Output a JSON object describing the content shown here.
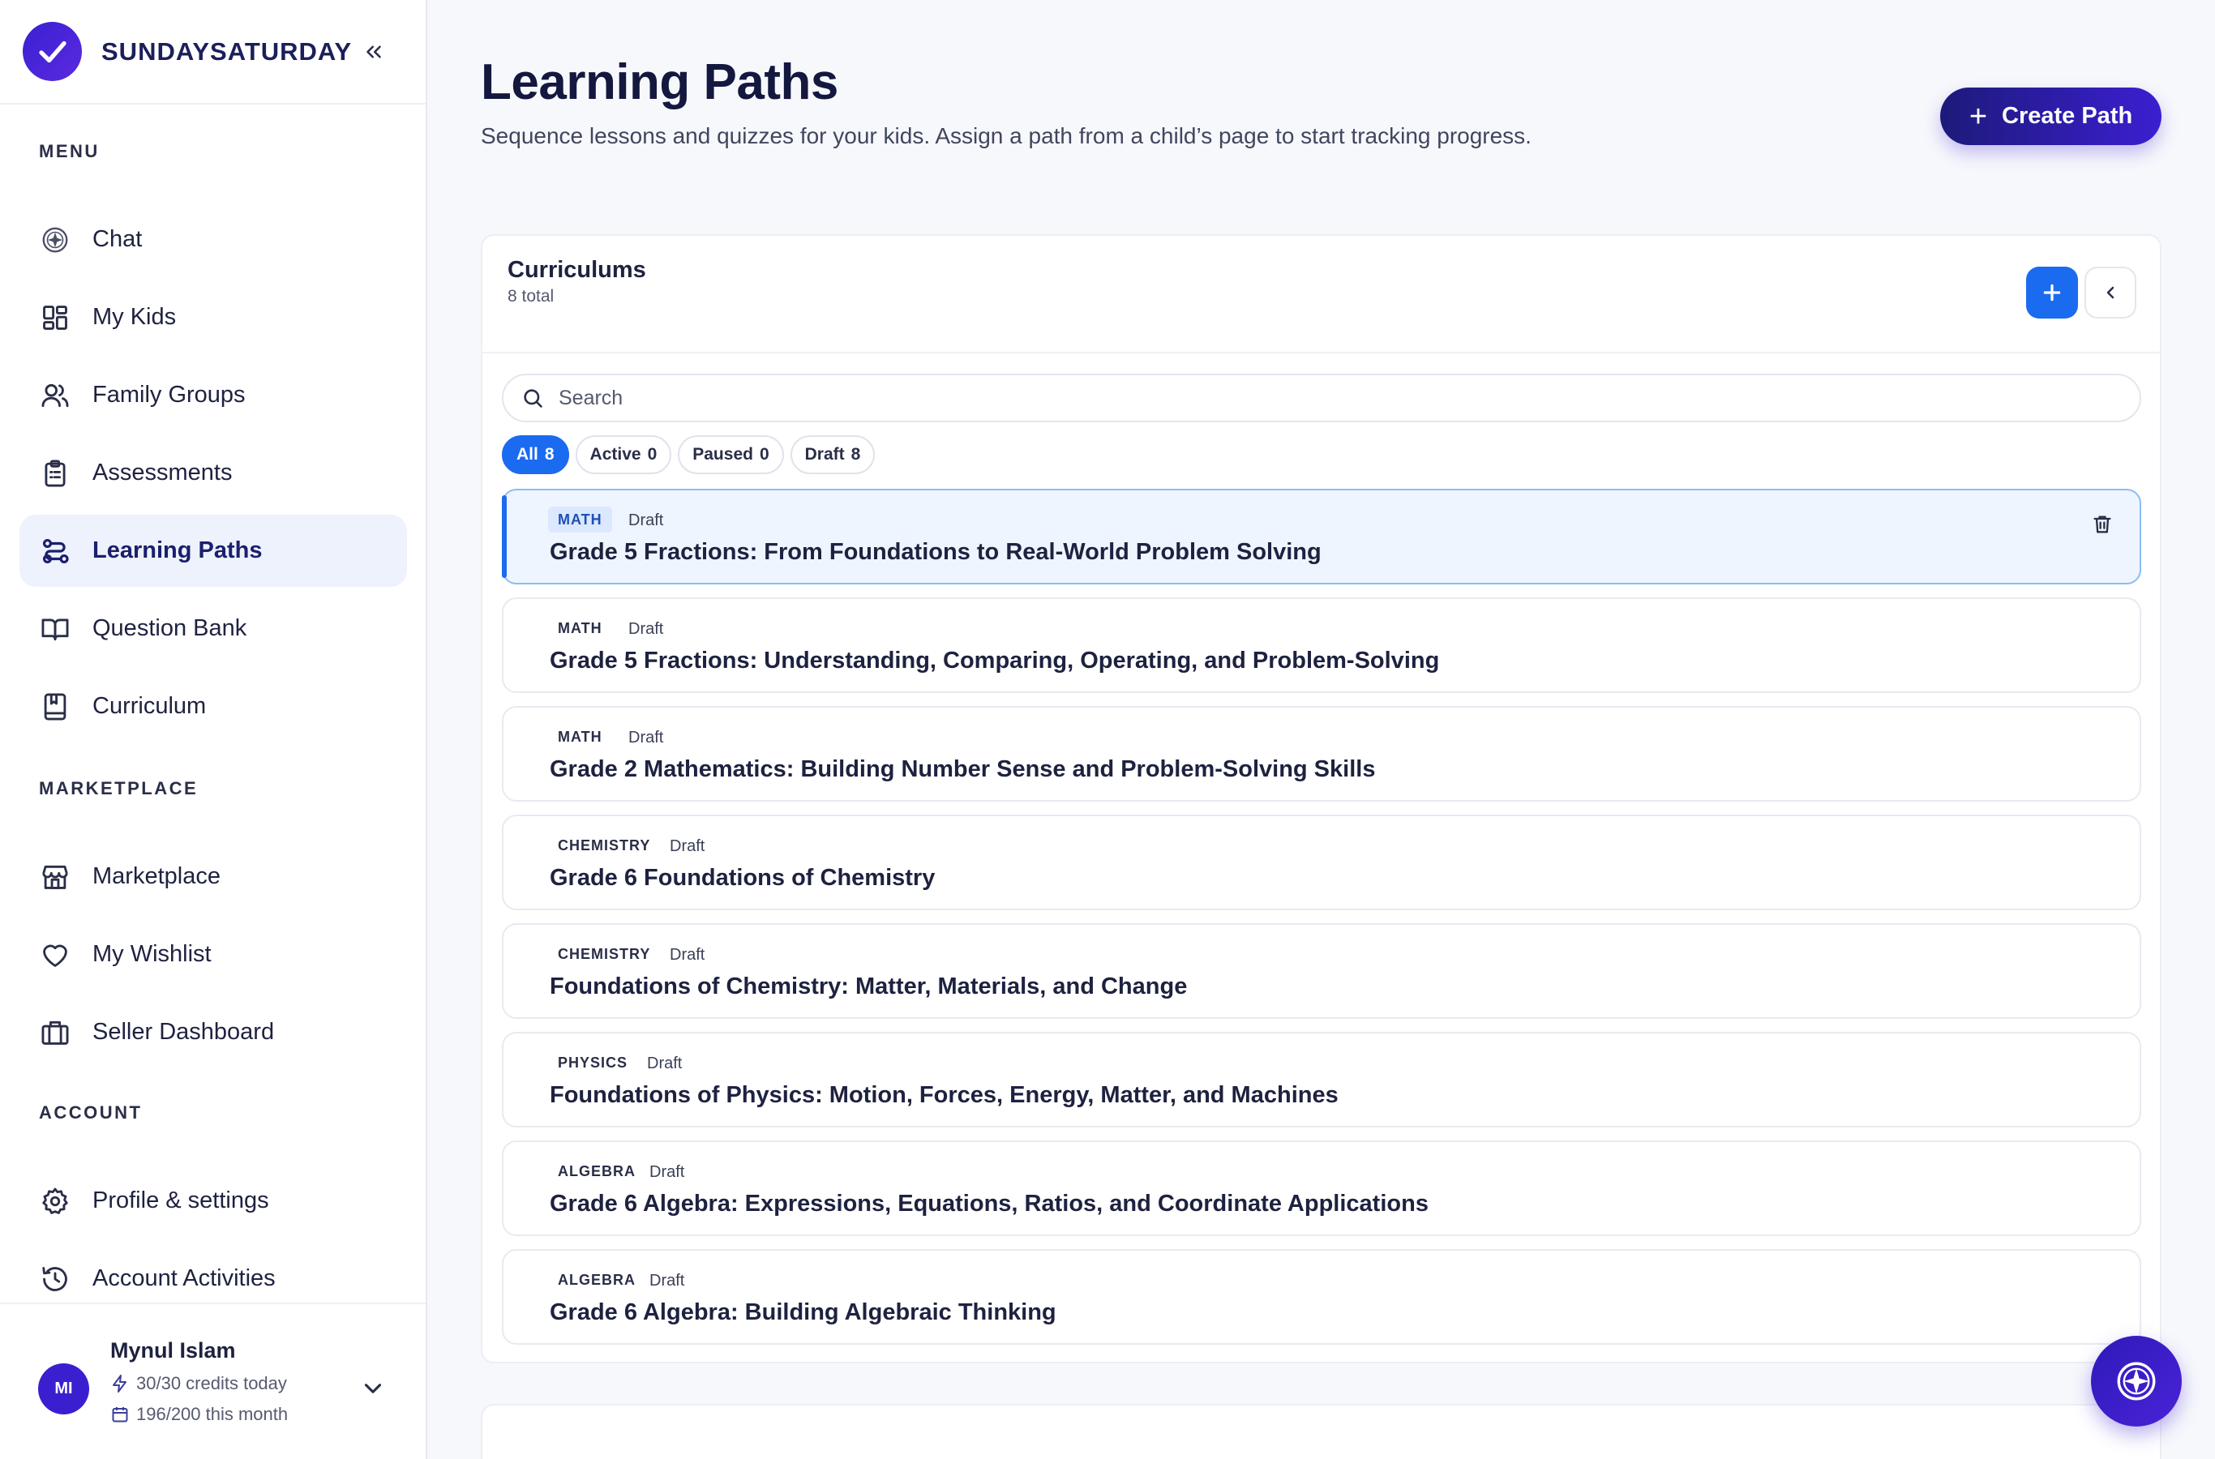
{
  "brand": {
    "name": "SUNDAYSATURDAY"
  },
  "sidebar": {
    "sections": {
      "menu": "MENU",
      "marketplace": "MARKETPLACE",
      "account": "ACCOUNT"
    },
    "items": [
      {
        "label": "Chat",
        "icon": "chat-sparkle-icon"
      },
      {
        "label": "My Kids",
        "icon": "grid-icon"
      },
      {
        "label": "Family Groups",
        "icon": "users-icon"
      },
      {
        "label": "Assessments",
        "icon": "clipboard-icon"
      },
      {
        "label": "Learning Paths",
        "icon": "route-icon",
        "active": true
      },
      {
        "label": "Question Bank",
        "icon": "open-book-icon"
      },
      {
        "label": "Curriculum",
        "icon": "book-icon"
      },
      {
        "label": "Marketplace",
        "icon": "store-icon"
      },
      {
        "label": "My Wishlist",
        "icon": "heart-icon"
      },
      {
        "label": "Seller Dashboard",
        "icon": "briefcase-icon"
      },
      {
        "label": "Profile & settings",
        "icon": "gear-icon"
      },
      {
        "label": "Account Activities",
        "icon": "history-icon"
      }
    ]
  },
  "user": {
    "initials": "MI",
    "name": "Mynul Islam",
    "credits_today": "30/30 credits today",
    "credits_month": "196/200 this month"
  },
  "header": {
    "title": "Learning Paths",
    "subtitle": "Sequence lessons and quizzes for your kids. Assign a path from a child’s page to start tracking progress.",
    "create_button": "Create Path"
  },
  "curriculums": {
    "title": "Curriculums",
    "count": "8 total",
    "search_placeholder": "Search",
    "filters": [
      {
        "label": "All",
        "count": "8",
        "active": true
      },
      {
        "label": "Active",
        "count": "0"
      },
      {
        "label": "Paused",
        "count": "0"
      },
      {
        "label": "Draft",
        "count": "8"
      }
    ],
    "items": [
      {
        "subject": "MATH",
        "status": "Draft",
        "title": "Grade 5 Fractions: From Foundations to Real-World Problem Solving",
        "selected": true
      },
      {
        "subject": "MATH",
        "status": "Draft",
        "title": "Grade 5 Fractions: Understanding, Comparing, Operating, and Problem-Solving"
      },
      {
        "subject": "MATH",
        "status": "Draft",
        "title": "Grade 2 Mathematics: Building Number Sense and Problem-Solving Skills"
      },
      {
        "subject": "CHEMISTRY",
        "status": "Draft",
        "title": "Grade 6 Foundations of Chemistry"
      },
      {
        "subject": "CHEMISTRY",
        "status": "Draft",
        "title": "Foundations of Chemistry: Matter, Materials, and Change"
      },
      {
        "subject": "PHYSICS",
        "status": "Draft",
        "title": "Foundations of Physics: Motion, Forces, Energy, Matter, and Machines"
      },
      {
        "subject": "ALGEBRA",
        "status": "Draft",
        "title": "Grade 6 Algebra: Expressions, Equations, Ratios, and Coordinate Applications"
      },
      {
        "subject": "ALGEBRA",
        "status": "Draft",
        "title": "Grade 6 Algebra: Building Algebraic Thinking"
      }
    ]
  },
  "colors": {
    "accent": "#1a6bf0",
    "brand": "#3b1fd1",
    "active_nav_bg": "#eef2fd",
    "selected_row_bg": "#eef5ff"
  }
}
